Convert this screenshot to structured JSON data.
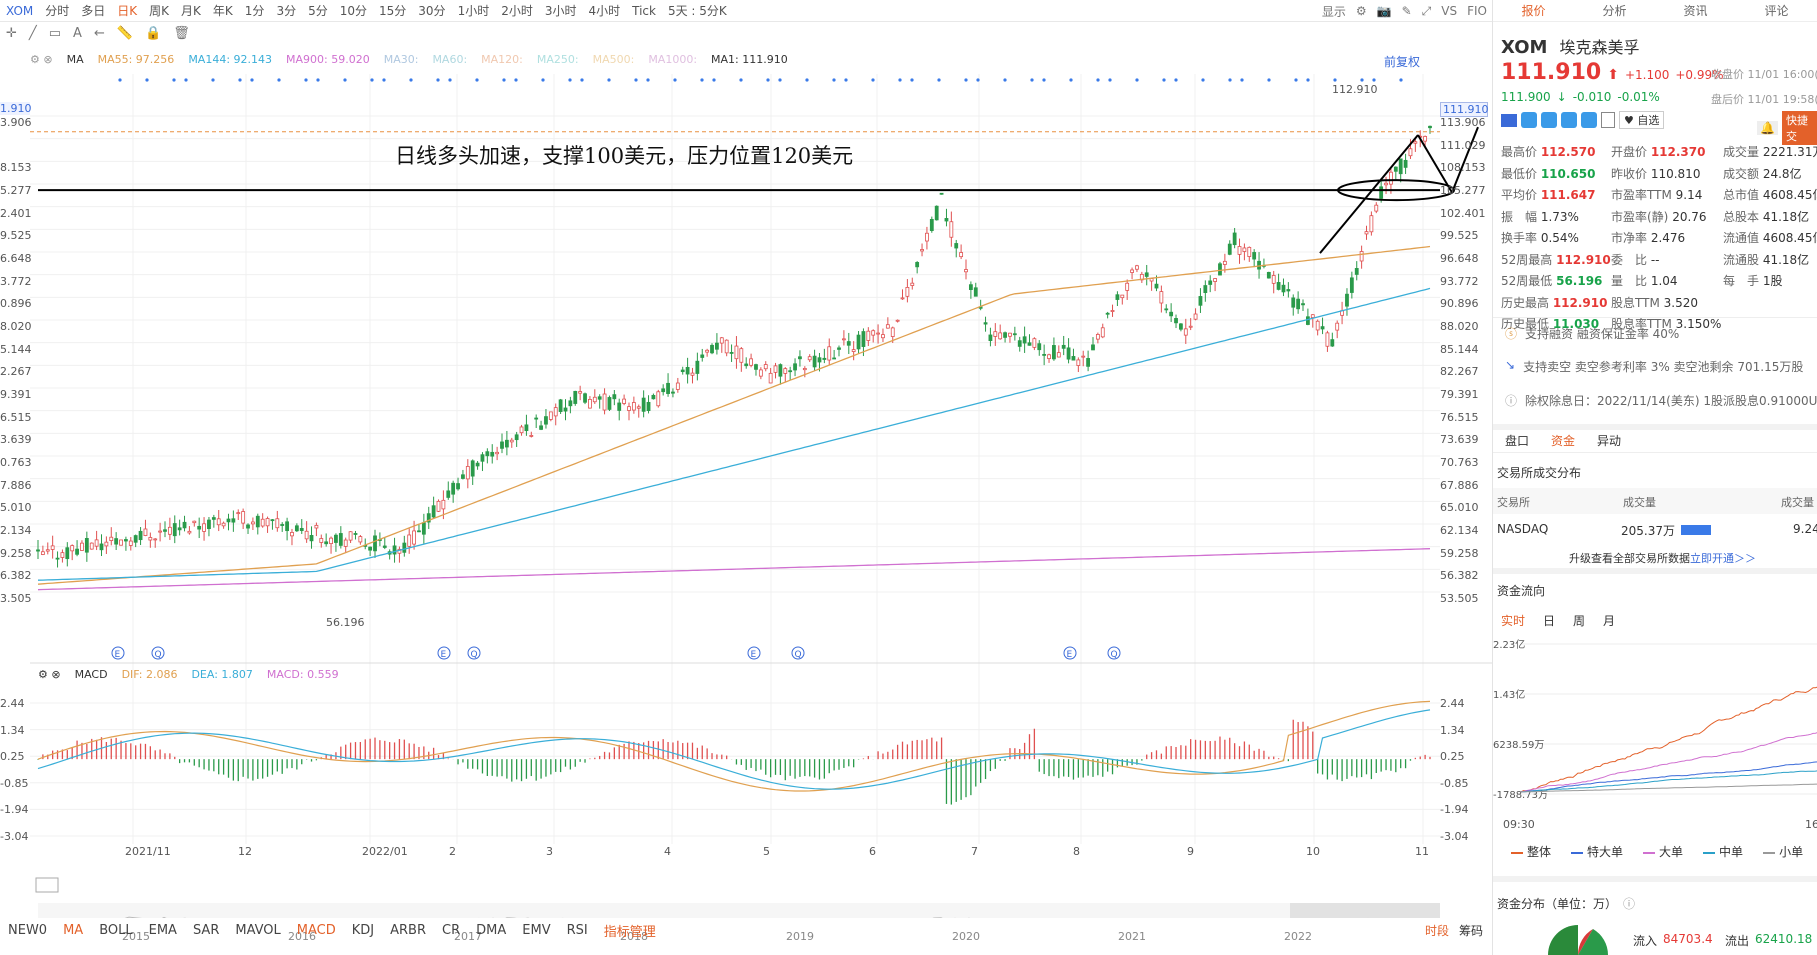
{
  "toolbar": {
    "symbol": "XOM",
    "periods": [
      "分时",
      "多日",
      "日K",
      "周K",
      "月K",
      "年K",
      "1分",
      "3分",
      "5分",
      "10分",
      "15分",
      "30分",
      "1小时",
      "2小时",
      "3小时",
      "4小时",
      "Tick",
      "5天 : 5分K"
    ],
    "active": "日K",
    "right": [
      "显示",
      "VS",
      "FIO"
    ]
  },
  "main_chart": {
    "indicator_label": "MA",
    "ma": [
      {
        "label": "MA55:",
        "value": "97.256",
        "color": "#e0a050"
      },
      {
        "label": "MA144:",
        "value": "92.143",
        "color": "#3aaed8"
      },
      {
        "label": "MA900:",
        "value": "59.020",
        "color": "#d070d0"
      },
      {
        "label": "MA30:",
        "value": "",
        "color": "#b0c8e0"
      },
      {
        "label": "MA60:",
        "value": "",
        "color": "#b0d8e0"
      },
      {
        "label": "MA120:",
        "value": "",
        "color": "#f0c8b0"
      },
      {
        "label": "MA250:",
        "value": "",
        "color": "#b0e0e0"
      },
      {
        "label": "MA500:",
        "value": "",
        "color": "#f0d8b0"
      },
      {
        "label": "MA1000:",
        "value": "",
        "color": "#e0c0e0"
      },
      {
        "label": "MA1:",
        "value": "111.910",
        "color": "#333333"
      }
    ],
    "adjust": "前复权",
    "annotation": "日线多头加速，支撑100美元，压力位置120美元",
    "high_label": "112.910",
    "low_label": "56.196",
    "price_tag": "111.910",
    "left_tag": "1.910",
    "right_axis": [
      "113.906",
      "111.029",
      "108.153",
      "105.277",
      "102.401",
      "99.525",
      "96.648",
      "93.772",
      "90.896",
      "88.020",
      "85.144",
      "82.267",
      "79.391",
      "76.515",
      "73.639",
      "70.763",
      "67.886",
      "65.010",
      "62.134",
      "59.258",
      "56.382",
      "53.505"
    ],
    "left_axis": [
      "3.906",
      "",
      "8.153",
      "5.277",
      "2.401",
      "9.525",
      "6.648",
      "3.772",
      "0.896",
      "8.020",
      "5.144",
      "2.267",
      "9.391",
      "6.515",
      "3.639",
      "0.763",
      "7.886",
      "5.010",
      "2.134",
      "9.258",
      "6.382",
      "3.505"
    ]
  },
  "macd": {
    "label": "MACD",
    "dif": "DIF: 2.086",
    "dea": "DEA: 1.807",
    "macd": "MACD: 0.559",
    "axis": [
      "2.44",
      "1.34",
      "0.25",
      "-0.85",
      "-1.94",
      "-3.04"
    ]
  },
  "xaxis": [
    "2021/11",
    "12",
    "2022/01",
    "2",
    "3",
    "4",
    "5",
    "6",
    "7",
    "8",
    "9",
    "10",
    "11"
  ],
  "overview_years": [
    "2015",
    "2016",
    "2017",
    "2018",
    "2019",
    "2020",
    "2021",
    "2022"
  ],
  "indicators": [
    "NEW0",
    "MA",
    "BOLL",
    "EMA",
    "SAR",
    "MAVOL",
    "MACD",
    "KDJ",
    "ARBR",
    "CR",
    "DMA",
    "EMV",
    "RSI",
    "指标管理"
  ],
  "indicators_active": [
    "MA",
    "MACD",
    "指标管理"
  ],
  "bottom_right": [
    "时段",
    "筹码"
  ],
  "panel": {
    "tabs": [
      "报价",
      "分析",
      "资讯",
      "评论"
    ],
    "ticker": "XOM",
    "name": "埃克森美孚",
    "price": "111.910",
    "change": "+1.100",
    "pct": "+0.99%",
    "close_note": "收盘价 11/01 16:00(美",
    "after_price": "111.900",
    "after_change": "-0.010",
    "after_pct": "-0.01%",
    "after_note": "盘后价 11/01 19:58(美",
    "fav": "自选",
    "quick": "快捷交",
    "stats": [
      [
        [
          "最高价",
          "112.570",
          "red"
        ],
        [
          "开盘价",
          "112.370",
          "red"
        ],
        [
          "成交量",
          "2221.31万",
          ""
        ]
      ],
      [
        [
          "最低价",
          "110.650",
          "green"
        ],
        [
          "昨收价",
          "110.810",
          ""
        ],
        [
          "成交额",
          "24.8亿",
          ""
        ]
      ],
      [
        [
          "平均价",
          "111.647",
          "red"
        ],
        [
          "市盈率TTM",
          "9.14",
          ""
        ],
        [
          "总市值",
          "4608.45亿",
          ""
        ]
      ],
      [
        [
          "振　幅",
          "1.73%",
          ""
        ],
        [
          "市盈率(静)",
          "20.76",
          ""
        ],
        [
          "总股本",
          "41.18亿",
          ""
        ]
      ],
      [
        [
          "换手率",
          "0.54%",
          ""
        ],
        [
          "市净率",
          "2.476",
          ""
        ],
        [
          "流通值",
          "4608.45亿",
          ""
        ]
      ],
      [
        [
          "52周最高",
          "112.910",
          "red"
        ],
        [
          "委　比",
          "--",
          ""
        ],
        [
          "流通股",
          "41.18亿",
          ""
        ]
      ],
      [
        [
          "52周最低",
          "56.196",
          "green"
        ],
        [
          "量　比",
          "1.04",
          ""
        ],
        [
          "每　手",
          "1股",
          ""
        ]
      ],
      [
        [
          "历史最高",
          "112.910",
          "red"
        ],
        [
          "股息TTM",
          "3.520",
          ""
        ],
        [
          "",
          "",
          ""
        ]
      ],
      [
        [
          "历史最低",
          "11.030",
          "green"
        ],
        [
          "股息率TTM",
          "3.150%",
          ""
        ],
        [
          "",
          "",
          ""
        ]
      ]
    ],
    "margin": "支持融资  融资保证金率 40%",
    "short": "支持卖空  卖空参考利率 3%  卖空池剩余 701.15万股",
    "dividend": "除权除息日：2022/11/14(美东)  1股派股息0.91000U",
    "sub_tabs": [
      "盘口",
      "资金",
      "异动"
    ],
    "exchange_title": "交易所成交分布",
    "exchange_header": [
      "交易所",
      "成交量",
      "成交量"
    ],
    "exchange_row": [
      "NASDAQ",
      "205.37万",
      "9.24"
    ],
    "upgrade": "升级查看全部交易所数据",
    "upgrade_link": "立即开通＞＞",
    "flow_title": "资金流向",
    "flow_tabs": [
      "实时",
      "日",
      "周",
      "月"
    ],
    "flow_axis": [
      "2.23亿",
      "1.43亿",
      "6238.59万",
      "-1788.73万"
    ],
    "flow_time": [
      "09:30",
      "16"
    ],
    "flow_legend": [
      [
        "整体",
        "#e3612a"
      ],
      [
        "特大单",
        "#3a6ad8"
      ],
      [
        "大单",
        "#d070d0"
      ],
      [
        "中单",
        "#2aa0c8"
      ],
      [
        "小单",
        "#999999"
      ]
    ],
    "dist_title": "资金分布（单位：万）",
    "inflow_label": "流入",
    "inflow": "84703.4",
    "outflow_label": "流出",
    "outflow": "62410.18"
  }
}
